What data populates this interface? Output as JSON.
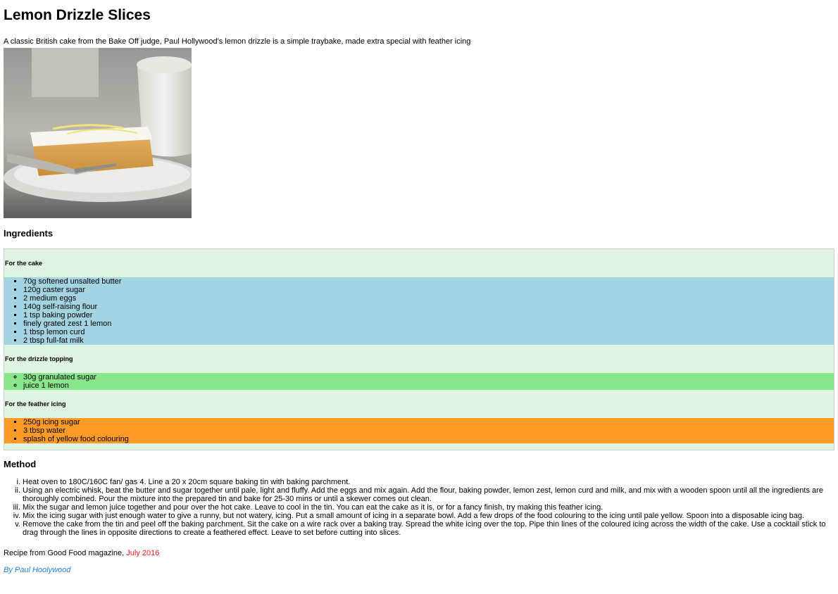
{
  "title": "Lemon Drizzle Slices",
  "intro": "A classic British cake from the Bake Off judge, Paul Hollywood's lemon drizzle is a simple traybake, made extra special with feather icing",
  "ingredients_heading": "Ingredients",
  "ingredient_groups": [
    {
      "heading": "For the cake",
      "items": [
        "70g softened unsalted butter",
        "120g caster sugar",
        "2 medium eggs",
        "140g self-raising flour",
        "1 tsp baking powder",
        "finely grated zest 1 lemon",
        "1 tbsp lemon curd",
        "2 tbsp full-fat milk"
      ]
    },
    {
      "heading": "For the drizzle topping",
      "items": [
        "30g granulated sugar",
        "juice 1 lemon"
      ]
    },
    {
      "heading": "For the feather icing",
      "items": [
        "250g icing sugar",
        "3 tbsp water",
        "splash of yellow food colouring"
      ]
    }
  ],
  "method_heading": "Method",
  "method_steps": [
    "Heat oven to 180C/160C fan/ gas 4. Line a 20 x 20cm square baking tin with baking parchment.",
    "Using an electric whisk, beat the butter and sugar together until pale, light and fluffy. Add the eggs and mix again. Add the flour, baking powder, lemon zest, lemon curd and milk, and mix with a wooden spoon until all the ingredients are thoroughly combined. Pour the mixture into the prepared tin and bake for 25-30 mins or until a skewer comes out clean.",
    "Mix the sugar and lemon juice together and pour over the hot cake. Leave to cool in the tin. You can eat the cake as it is, or for a fancy finish, try making this feather icing.",
    "Mix the icing sugar with just enough water to give a runny, but not watery, icing. Put a small amount of icing in a separate bowl. Add a few drops of the food colouring to the icing until pale yellow. Spoon into a disposable icing bag.",
    "Remove the cake from the tin and peel off the baking parchment. Sit the cake on a wire rack over a baking tray. Spread the white icing over the top. Pipe thin lines of the coloured icing across the width of the cake. Use a cocktail stick to drag through the lines in opposite directions to create a feathered effect. Leave to set before cutting into slices."
  ],
  "source": {
    "prefix": "Recipe from Good Food magazine, ",
    "date": "July 2016"
  },
  "byline": "By Paul Hoolywood",
  "colors": {
    "cake_list_bg": "#a4d3e2",
    "drizzle_list_bg": "#89e68c",
    "icing_list_bg": "#fe9b27",
    "box_bg": "#dff4e1",
    "date_color": "#ff1a1a",
    "byline_color": "#1f7fe0"
  }
}
